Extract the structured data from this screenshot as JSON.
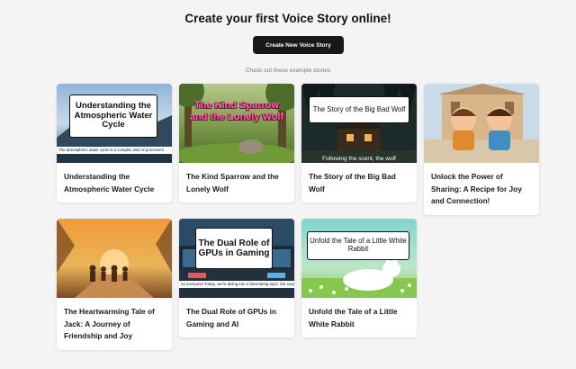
{
  "page": {
    "title": "Create your first Voice Story online!",
    "cta_label": "Create New Voice Story",
    "subtitle": "Check out these example stories"
  },
  "cards": [
    {
      "title": "Understanding the Atmospheric Water Cycle",
      "overlay": "Understanding the Atmospheric Water Cycle",
      "caption": "The atmospheric water cycle is a complex web of processes"
    },
    {
      "title": "The Kind Sparrow and the Lonely Wolf",
      "overlay": "The Kind Sparrow and the Lonely Wolf"
    },
    {
      "title": "The Story of the Big Bad Wolf",
      "overlay": "The Story of the Big Bad Wolf",
      "caption": "Following the scent, the wolf"
    },
    {
      "title": "Unlock the Power of Sharing: A Recipe for Joy and Connection!"
    },
    {
      "title": "The Heartwarming Tale of Jack: A Journey of Friendship and Joy"
    },
    {
      "title": "The Dual Role of GPUs in Gaming and AI",
      "overlay": "The Dual Role of GPUs in Gaming",
      "caption": "ny everyone! Today, we're diving into a fascinating topic: the surpri"
    },
    {
      "title": "Unfold the Tale of a Little White Rabbit",
      "overlay": "Unfold the Tale of a Little White Rabbit"
    }
  ]
}
